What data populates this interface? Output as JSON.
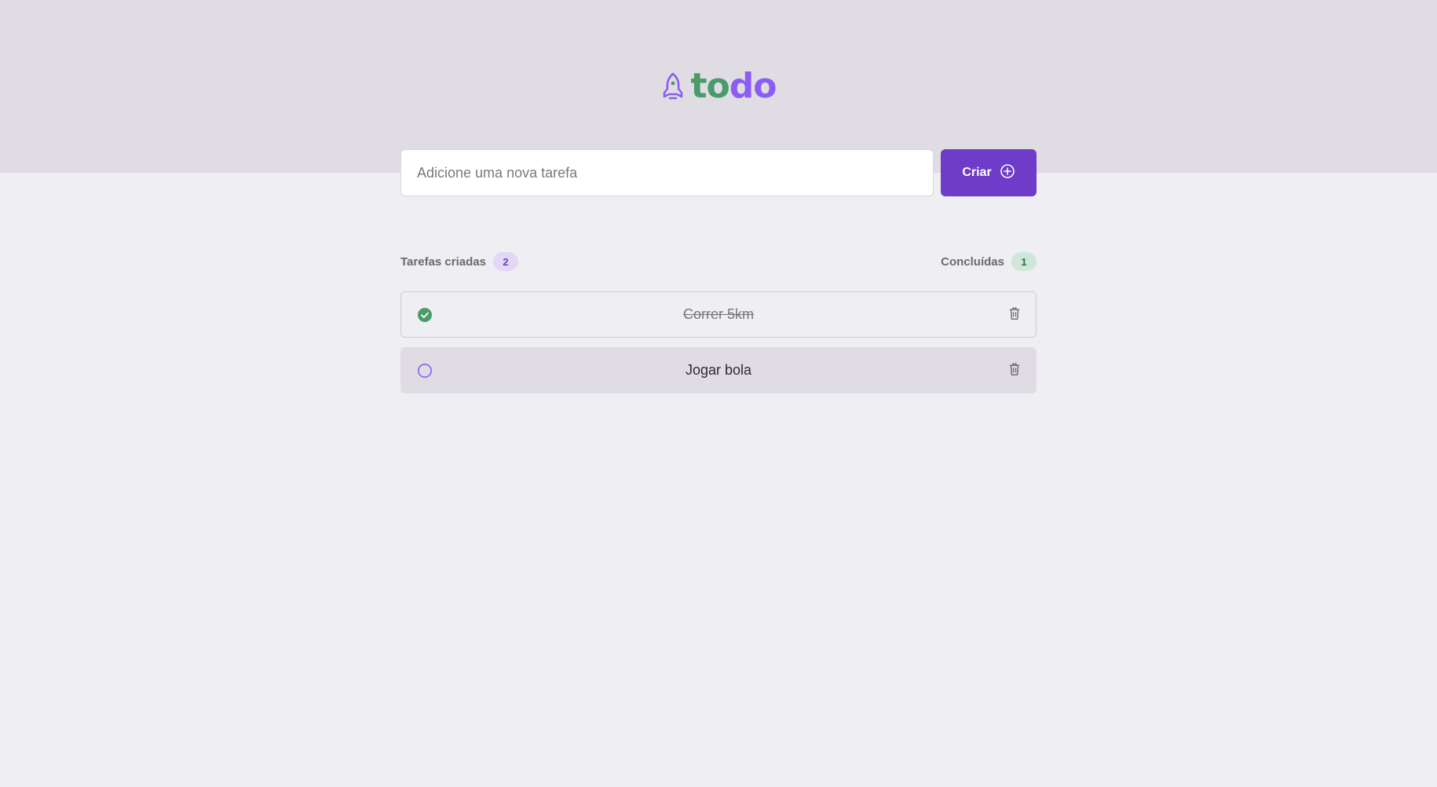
{
  "app": {
    "logo_part1": "to",
    "logo_part2": "do",
    "logo_icon": "rocket-icon"
  },
  "create": {
    "placeholder": "Adicione uma nova tarefa",
    "button_label": "Criar",
    "button_icon": "plus-circle-icon"
  },
  "counters": {
    "created_label": "Tarefas criadas",
    "created_count": "2",
    "done_label": "Concluídas",
    "done_count": "1"
  },
  "tasks": [
    {
      "text": "Correr 5km",
      "completed": true
    },
    {
      "text": "Jogar bola",
      "completed": false
    }
  ],
  "colors": {
    "brand_purple": "#8B5CF6",
    "button_purple": "#6E3CC8",
    "brand_green": "#4A9B6A",
    "header_band": "#DFDDE3",
    "page_background": "#EFEEF3"
  }
}
